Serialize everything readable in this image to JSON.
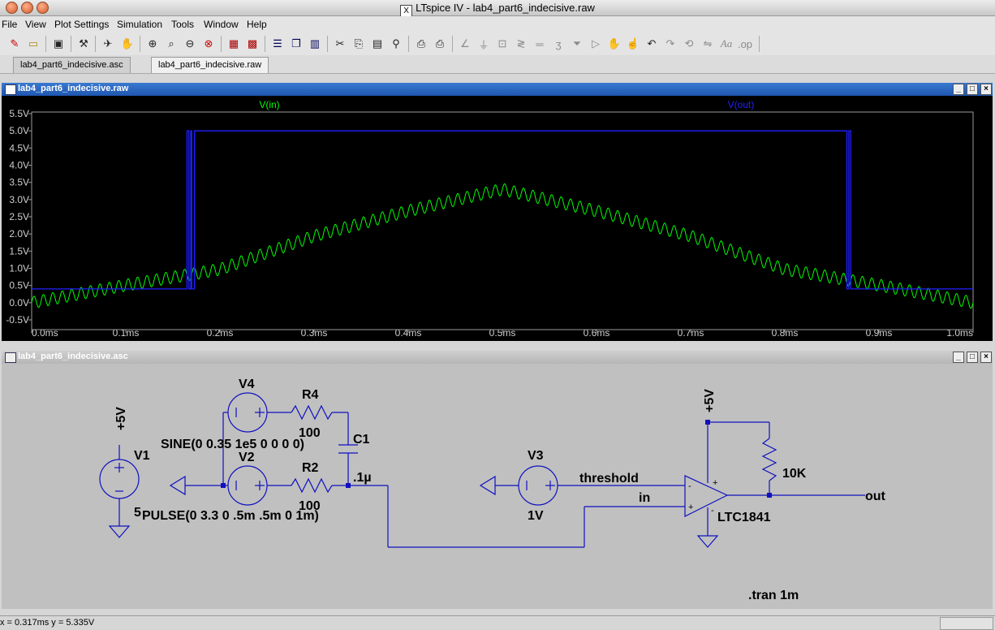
{
  "window": {
    "title": "LTspice IV - lab4_part6_indecisive.raw",
    "x_logo": "X"
  },
  "menu": [
    "File",
    "View",
    "Plot Settings",
    "Simulation",
    "Tools",
    "Window",
    "Help"
  ],
  "toolbar_icons": [
    "new-schematic-icon",
    "open-icon",
    "save-icon",
    "control-panel-icon",
    "run-icon",
    "halt-icon",
    "zoom-in-icon",
    "zoom-area-icon",
    "zoom-out-icon",
    "zoom-cancel-icon",
    "autorange-icon",
    "zoom-full-icon",
    "tile-horizontal-icon",
    "cascade-icon",
    "tile-vertical-icon",
    "cut-icon",
    "copy-icon",
    "paste-icon",
    "find-icon",
    "print-preview-icon",
    "print-icon",
    "wire-icon",
    "ground-icon",
    "label-net-icon",
    "resistor-icon",
    "capacitor-icon",
    "inductor-icon",
    "diode-icon",
    "component-icon",
    "move-icon",
    "drag-icon",
    "undo-icon",
    "redo-icon",
    "rotate-icon",
    "mirror-icon",
    "text-icon",
    "spice-directive-icon"
  ],
  "tabs": [
    {
      "label": "lab4_part6_indecisive.asc",
      "active": false
    },
    {
      "label": "lab4_part6_indecisive.raw",
      "active": true
    }
  ],
  "plot_window": {
    "title": "lab4_part6_indecisive.raw",
    "trace_in_label": "V(in)",
    "trace_out_label": "V(out)",
    "trace_in_color": "#00ff00",
    "trace_out_color": "#2020ff",
    "y_ticks": [
      "5.5V",
      "5.0V",
      "4.5V",
      "4.0V",
      "3.5V",
      "3.0V",
      "2.5V",
      "2.0V",
      "1.5V",
      "1.0V",
      "0.5V",
      "0.0V",
      "-0.5V"
    ],
    "x_ticks": [
      "0.0ms",
      "0.1ms",
      "0.2ms",
      "0.3ms",
      "0.4ms",
      "0.5ms",
      "0.6ms",
      "0.7ms",
      "0.8ms",
      "0.9ms",
      "1.0ms"
    ]
  },
  "chart_data": {
    "type": "line",
    "xlabel": "",
    "ylabel": "",
    "x_unit": "ms",
    "xlim": [
      0,
      1.0
    ],
    "ylim": [
      -0.5,
      5.5
    ],
    "grid": false,
    "legend": "top",
    "series": [
      {
        "name": "V(in)",
        "description_points": {
          "x": [
            0.0,
            0.1,
            0.2,
            0.3,
            0.4,
            0.5,
            0.6,
            0.7,
            0.8,
            0.9,
            1.0
          ],
          "y": [
            0.0,
            0.51,
            0.97,
            1.94,
            2.67,
            3.3,
            2.67,
            1.94,
            0.97,
            0.51,
            0.0
          ]
        },
        "ripple_amplitude": 0.175,
        "ripple_cycles": 100
      },
      {
        "name": "V(out)",
        "x": [
          0.0,
          0.163,
          0.165,
          0.167,
          0.169,
          0.17,
          0.173,
          0.864,
          0.866,
          0.868,
          0.87,
          0.873,
          1.0
        ],
        "y": [
          0.4,
          0.4,
          5.0,
          0.4,
          5.0,
          0.4,
          5.0,
          5.0,
          0.4,
          5.0,
          0.4,
          0.4,
          0.4
        ]
      }
    ]
  },
  "schematic_window": {
    "title": "lab4_part6_indecisive.asc",
    "labels": {
      "v1": "V1",
      "v1_value": "5",
      "plus5_a": "+5V",
      "v4": "V4",
      "r4": "R4",
      "r4_value": "100",
      "sine": "SINE(0 0.35 1e5 0 0 0 0)",
      "c1": "C1",
      "c1_value": ".1µ",
      "v2": "V2",
      "r2": "R2",
      "r2_value": "100",
      "pulse": "PULSE(0 3.3 0 .5m .5m 0 1m)",
      "v3": "V3",
      "v3_value": "1V",
      "threshold": "threshold",
      "in": "in",
      "plus5_b": "+5V",
      "r10k": "10K",
      "opamp": "LTC1841",
      "out": "out",
      "tran": ".tran 1m"
    }
  },
  "status": {
    "text": "x = 0.317ms    y = 5.335V"
  }
}
